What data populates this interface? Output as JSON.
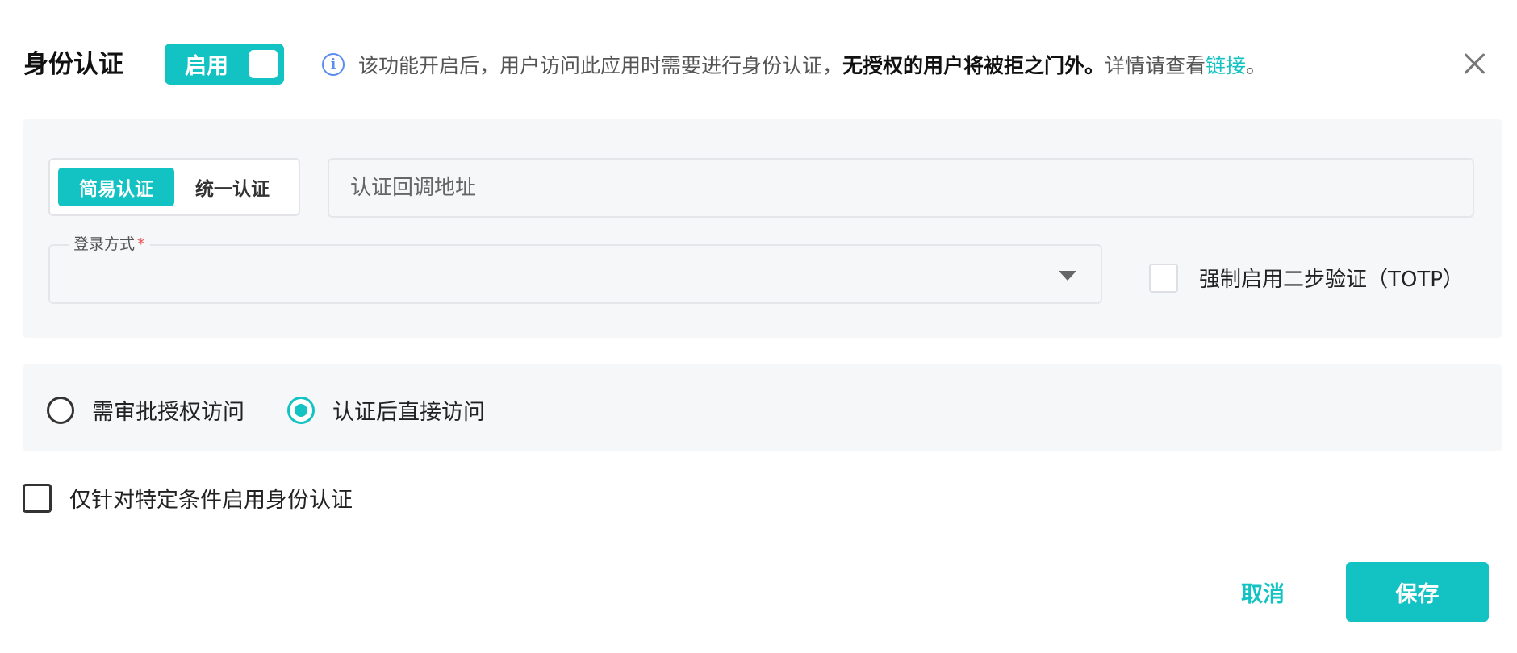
{
  "header": {
    "title": "身份认证",
    "toggle_label": "启用",
    "info_icon": "info-circle-icon",
    "info_text_prefix": "该功能开启后，用户访问此应用时需要进行身份认证，",
    "info_text_bold": "无授权的用户将被拒之门外。",
    "info_text_details": "详情请查看",
    "info_link": "链接",
    "info_text_suffix": "。",
    "close_icon": "close-icon"
  },
  "auth_config": {
    "tabs": [
      {
        "label": "简易认证",
        "active": true
      },
      {
        "label": "统一认证",
        "active": false
      }
    ],
    "callback_placeholder": "认证回调地址",
    "callback_value": "",
    "login_method_label": "登录方式",
    "login_method_required": "*",
    "login_method_value": "",
    "totp_label": "强制启用二步验证（TOTP）",
    "totp_checked": false
  },
  "access_mode": {
    "options": [
      {
        "label": "需审批授权访问",
        "checked": false
      },
      {
        "label": "认证后直接访问",
        "checked": true
      }
    ]
  },
  "condition": {
    "label": "仅针对特定条件启用身份认证",
    "checked": false
  },
  "footer": {
    "cancel_label": "取消",
    "save_label": "保存"
  },
  "colors": {
    "accent": "#13c2c2",
    "info_icon": "#5b8def",
    "panel_bg": "#f6f7f9",
    "required": "#e55555"
  }
}
